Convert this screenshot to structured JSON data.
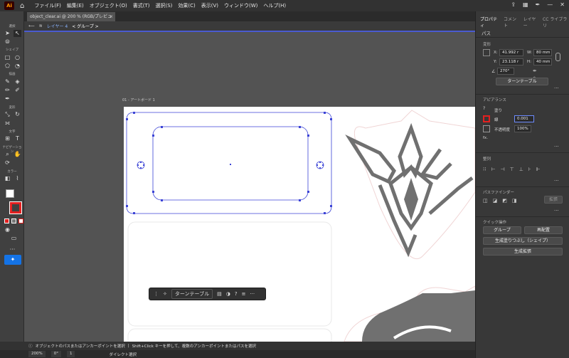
{
  "menubar": {
    "logo": "Ai",
    "items": [
      "ファイル(F)",
      "編集(E)",
      "オブジェクト(O)",
      "書式(T)",
      "選択(S)",
      "効果(C)",
      "表示(V)",
      "ウィンドウ(W)",
      "ヘルプ(H)"
    ]
  },
  "document": {
    "tab_title": "object_clear.ai @ 200 % (RGB/プレビュー)",
    "tab_close": "×"
  },
  "breadcrumb": {
    "layer": "レイヤー 4",
    "group": "< グループ >"
  },
  "toolbar": {
    "labels": [
      "選択",
      "シェイプ",
      "描画",
      "変形",
      "文字",
      "ナビゲーション",
      "カラー"
    ]
  },
  "artboard": {
    "label": "01 - アートボード 1"
  },
  "context_bar": {
    "button": "ターンテーブル"
  },
  "status": {
    "message": "オブジェクトのパスまたはアンカーポイントを選択",
    "message2": "Shift+Click キーを押して、複数のアンカーポイントまたはパスを選択"
  },
  "bottom": {
    "zoom": "200%",
    "rotation": "0°",
    "artboard_num": "1",
    "tool": "ダイレクト選択"
  },
  "right_panel": {
    "tabs": [
      "プロパティ",
      "コメント",
      "レイヤー",
      "CC ライブラリ"
    ],
    "object_type": "パス",
    "transform_title": "変形",
    "x_label": "X:",
    "x_value": "41.992 r",
    "y_label": "Y:",
    "y_value": "23.118 r",
    "w_label": "W:",
    "w_value": "80 mm",
    "h_label": "H:",
    "h_value": "40 mm",
    "angle_value": "270°",
    "turntable_button": "ターンテーブル",
    "appearance_title": "アピアランス",
    "fill_label": "塗り",
    "stroke_label": "線",
    "stroke_value": "0.001",
    "opacity_label": "不透明度",
    "opacity_value": "100%",
    "fx_label": "fx.",
    "align_title": "整列",
    "pathfinder_title": "パスファインダー",
    "expand_button": "拡張",
    "quick_actions_title": "クイック操作",
    "group_button": "グループ",
    "rearrange_button": "再配置",
    "generative_fill_shape_button": "生成塗りつぶし（シェイプ）",
    "generative_expand_button": "生成拡張"
  },
  "colors": {
    "selection": "#3c44d6",
    "stroke_active": "#e32020",
    "shape_gray": "#707070"
  }
}
